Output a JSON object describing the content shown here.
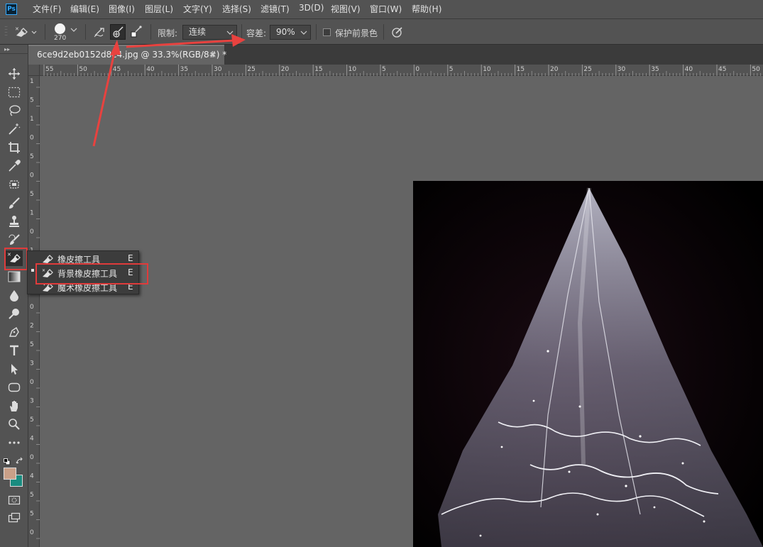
{
  "app": {
    "logo": "Ps"
  },
  "menu": [
    "文件(F)",
    "编辑(E)",
    "图像(I)",
    "图层(L)",
    "文字(Y)",
    "选择(S)",
    "滤镜(T)",
    "3D(D)",
    "视图(V)",
    "窗口(W)",
    "帮助(H)"
  ],
  "options": {
    "brush_size": "270",
    "limit_label": "限制:",
    "limit_value": "连续",
    "tolerance_label": "容差:",
    "tolerance_value": "90%",
    "protect_fg_label": "保护前景色",
    "protect_fg_checked": false
  },
  "document": {
    "tab_title": "6ce9d2eb0152d8e4.jpg @ 33.3%(RGB/8#) *",
    "close_glyph": "×"
  },
  "rulers": {
    "horizontal": [
      "55",
      "50",
      "45",
      "40",
      "35",
      "30",
      "25",
      "20",
      "15",
      "10",
      "5",
      "0",
      "5",
      "10",
      "15",
      "20",
      "25",
      "30",
      "35",
      "40",
      "45",
      "50"
    ],
    "vertical": [
      "1",
      "5",
      "1",
      "0",
      "5",
      "0",
      "5",
      "1",
      "0",
      "1",
      "5",
      "2",
      "0",
      "2",
      "5",
      "3",
      "0",
      "3",
      "5",
      "4",
      "0",
      "4",
      "5",
      "5",
      "0"
    ]
  },
  "flyout": [
    {
      "label": "橡皮擦工具",
      "key": "E",
      "icon": "eraser-icon"
    },
    {
      "label": "背景橡皮擦工具",
      "key": "E",
      "icon": "background-eraser-icon"
    },
    {
      "label": "魔术橡皮擦工具",
      "key": "E",
      "icon": "magic-eraser-icon"
    }
  ],
  "colors": {
    "foreground": "#c9a088",
    "background": "#1a8c80",
    "highlight": "#e03b3b"
  }
}
